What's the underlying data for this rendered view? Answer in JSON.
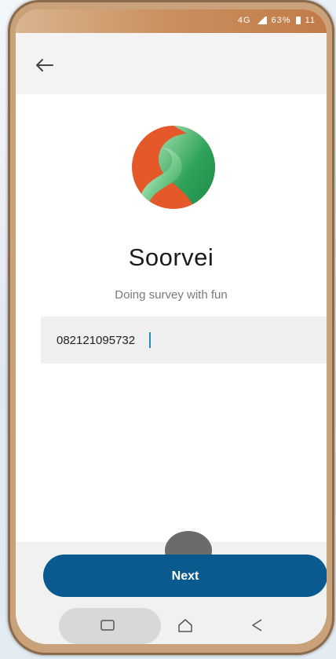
{
  "status_bar": {
    "network": "4G",
    "battery": "63%",
    "time": "11"
  },
  "app": {
    "title": "Soorvei",
    "tagline": "Doing survey with fun"
  },
  "form": {
    "phone_value": "082121095732"
  },
  "footer": {
    "next_label": "Next"
  },
  "colors": {
    "primary": "#0b5a8f",
    "logo_orange": "#e4582a",
    "logo_green": "#2ea35a"
  },
  "icons": {
    "back": "back-arrow-icon",
    "logo": "soorvei-logo-icon",
    "nav_recent": "recent-apps-icon",
    "nav_home": "home-icon",
    "nav_back": "nav-back-icon"
  }
}
